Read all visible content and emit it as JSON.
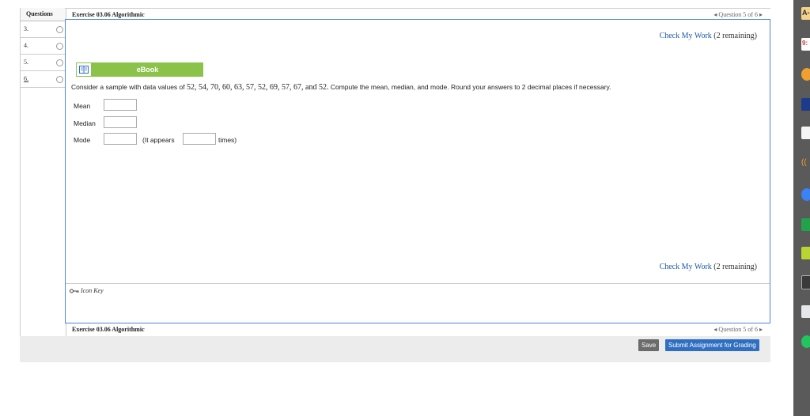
{
  "questions_panel": {
    "header": "Questions",
    "items": [
      {
        "number": "3."
      },
      {
        "number": "4."
      },
      {
        "number": "5."
      },
      {
        "number": "6."
      }
    ]
  },
  "exercise": {
    "title": "Exercise 03.06 Algorithmic",
    "question_nav": "Question 5 of 6"
  },
  "check": {
    "link_label": "Check My Work",
    "remaining": "(2 remaining)"
  },
  "ebook": {
    "label": "eBook"
  },
  "prompt": {
    "before": "Consider a sample with data values of",
    "values": "52, 54, 70, 60, 63, 57, 52, 69, 57, 67, and 52.",
    "after": "Compute the mean, median, and mode. Round your answers to 2 decimal places if necessary."
  },
  "fields": {
    "mean_label": "Mean",
    "median_label": "Median",
    "mode_label": "Mode",
    "it_appears": "(It appears",
    "times": "times)",
    "mean_value": "",
    "median_value": "",
    "mode_value": "",
    "mode_count_value": ""
  },
  "icon_key": {
    "label": "Icon Key"
  },
  "footer": {
    "save_label": "Save",
    "submit_label": "Submit Assignment for Grading"
  },
  "dock": {
    "top_label": "A-",
    "second_label": "9:"
  },
  "colors": {
    "frame_border": "#4f86d8",
    "ebook_green": "#8bc34a",
    "link_blue": "#1a56a8",
    "submit_blue": "#2f6fc2",
    "save_gray": "#6b6b6b"
  }
}
